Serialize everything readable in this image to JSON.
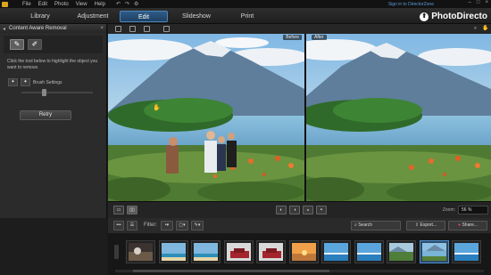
{
  "menubar": {
    "items": [
      "File",
      "Edit",
      "Photo",
      "View",
      "Help"
    ],
    "sign_in": "Sign in to DirectorZone"
  },
  "tabs": [
    {
      "label": "Library",
      "active": false
    },
    {
      "label": "Adjustment",
      "active": false
    },
    {
      "label": "Edit",
      "active": true
    },
    {
      "label": "Slideshow",
      "active": false
    },
    {
      "label": "Print",
      "active": false
    }
  ],
  "brand": {
    "name": "PhotoDirecto"
  },
  "left_panel": {
    "title": "Content Aware Removal",
    "instruction": "Click the tool below to highlight the object you want to remove.",
    "brush_settings": "Brush Settings",
    "brush_size_level": 0.3,
    "retry_label": "Retry"
  },
  "canvas": {
    "before_label": "Before",
    "after_label": "After"
  },
  "viewbar": {
    "zoom_label": "Zoom:",
    "zoom_value": "56 %"
  },
  "filterbar": {
    "filter_label": "Filter:",
    "search_placeholder": "Search",
    "export_label": "Export...",
    "share_label": "Share..."
  },
  "filmstrip": {
    "thumbnails": [
      "desert",
      "beach",
      "beach",
      "car",
      "car",
      "sunset",
      "sea",
      "sea",
      "landscape",
      "lake",
      "sea"
    ],
    "selected_index": 9
  },
  "colors": {
    "accent": "#2f5b86",
    "selected_thumb": "#4a8fd0",
    "link": "#5c9bd9"
  }
}
